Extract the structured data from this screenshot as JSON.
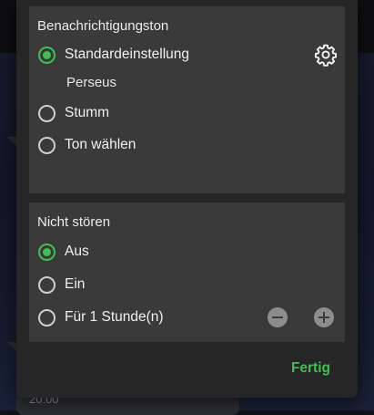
{
  "background": {
    "timestamp": "20:00"
  },
  "dialog": {
    "notification_sound": {
      "title": "Benachrichtigungston",
      "options": [
        {
          "label": "Standardeinstellung",
          "selected": true,
          "sub_label": "Perseus"
        },
        {
          "label": "Stumm",
          "selected": false
        },
        {
          "label": "Ton wählen",
          "selected": false
        }
      ],
      "settings_icon": "gear-icon"
    },
    "do_not_disturb": {
      "title": "Nicht stören",
      "options": [
        {
          "label": "Aus",
          "selected": true
        },
        {
          "label": "Ein",
          "selected": false
        },
        {
          "label": "Für 1 Stunde(n)",
          "selected": false
        }
      ],
      "decrease_icon": "minus-circle-icon",
      "increase_icon": "plus-circle-icon"
    },
    "done_label": "Fertig"
  },
  "colors": {
    "accent": "#3fbf51",
    "card": "#3a3a3a",
    "dialog": "#262626"
  }
}
